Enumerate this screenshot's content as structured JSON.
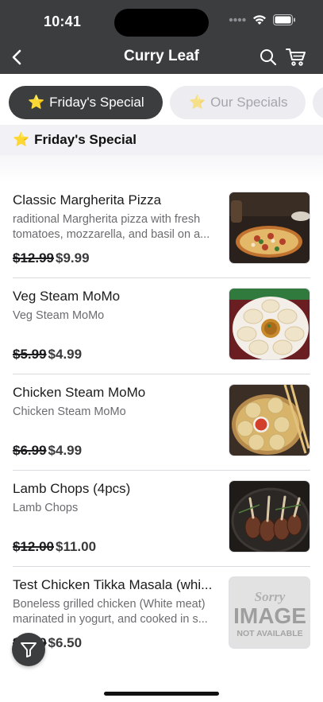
{
  "status_bar": {
    "time": "10:41"
  },
  "nav": {
    "title": "Curry Leaf"
  },
  "tabs": [
    {
      "label": "Friday's Special",
      "icon": "star-emoji",
      "active": true
    },
    {
      "label": "Our Specials",
      "icon": "star-emoji",
      "active": false
    }
  ],
  "section": {
    "title": "Friday's Special",
    "icon": "star-emoji"
  },
  "items": [
    {
      "name": "Classic Margherita Pizza",
      "description": "raditional Margherita pizza with fresh tomatoes, mozzarella, and basil on a...",
      "old_price": "$12.99",
      "price": "$9.99",
      "image": "pizza-photo"
    },
    {
      "name": "Veg Steam MoMo",
      "description": "Veg Steam MoMo",
      "old_price": "$5.99",
      "price": "$4.99",
      "image": "veg-momo-photo"
    },
    {
      "name": "Chicken Steam MoMo",
      "description": "Chicken Steam MoMo",
      "old_price": "$6.99",
      "price": "$4.99",
      "image": "chicken-momo-photo"
    },
    {
      "name": "Lamb Chops (4pcs)",
      "description": "Lamb Chops",
      "old_price": "$12.00",
      "price": "$11.00",
      "image": "lamb-chops-photo"
    },
    {
      "name": "Test Chicken Tikka Masala (whi...",
      "description": "Boneless grilled chicken (White meat) marinated in yogurt, and cooked in s...",
      "old_price": "$7.99",
      "price": "$6.50",
      "image": "image-not-available",
      "placeholder_text": {
        "line1": "Sorry",
        "line2": "IMAGE",
        "line3": "NOT AVAILABLE"
      }
    }
  ],
  "colors": {
    "dark": "#3b3d3f",
    "pill_inactive": "#ececf1",
    "section_bg": "#f2f2f6"
  }
}
